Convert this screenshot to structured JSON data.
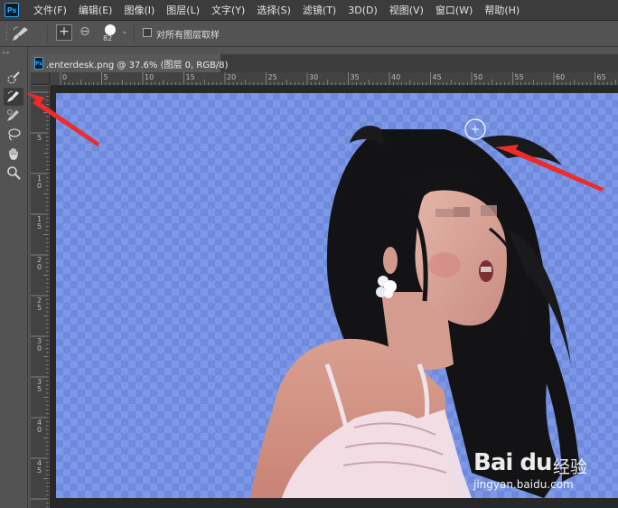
{
  "app": {
    "logo_text": "Ps"
  },
  "menu": [
    "文件(F)",
    "编辑(E)",
    "图像(I)",
    "图层(L)",
    "文字(Y)",
    "选择(S)",
    "滤镜(T)",
    "3D(D)",
    "视图(V)",
    "窗口(W)",
    "帮助(H)"
  ],
  "options_bar": {
    "brush_size": "82",
    "sample_all_layers_label": "对所有图层取样",
    "sample_all_layers_checked": false
  },
  "toolbar": {
    "tools": [
      {
        "name": "quick-selection-tool",
        "active": false
      },
      {
        "name": "refine-edge-brush-tool",
        "active": true
      },
      {
        "name": "brush-tool",
        "active": false
      },
      {
        "name": "lasso-tool",
        "active": false
      },
      {
        "name": "hand-tool",
        "active": false
      },
      {
        "name": "zoom-tool",
        "active": false
      }
    ]
  },
  "document": {
    "tab_title": ".enterdesk.png @ 37.6% (图层 0, RGB/8)",
    "h_ruler_labels": [
      "0",
      "5",
      "10",
      "15",
      "20",
      "25",
      "30",
      "35",
      "40",
      "45",
      "50",
      "55",
      "60",
      "65"
    ],
    "v_ruler_labels": [
      "5",
      "10",
      "15",
      "20",
      "25",
      "30",
      "35",
      "40",
      "45",
      "50"
    ]
  },
  "watermark": {
    "logo": "Bai du",
    "cn": "经验",
    "url": "jingyan.baidu.com"
  },
  "colors": {
    "checker_light": "#7c98e6",
    "checker_dark": "#6f8adc",
    "arrow": "#ee2a2a",
    "hair": "#141416"
  }
}
